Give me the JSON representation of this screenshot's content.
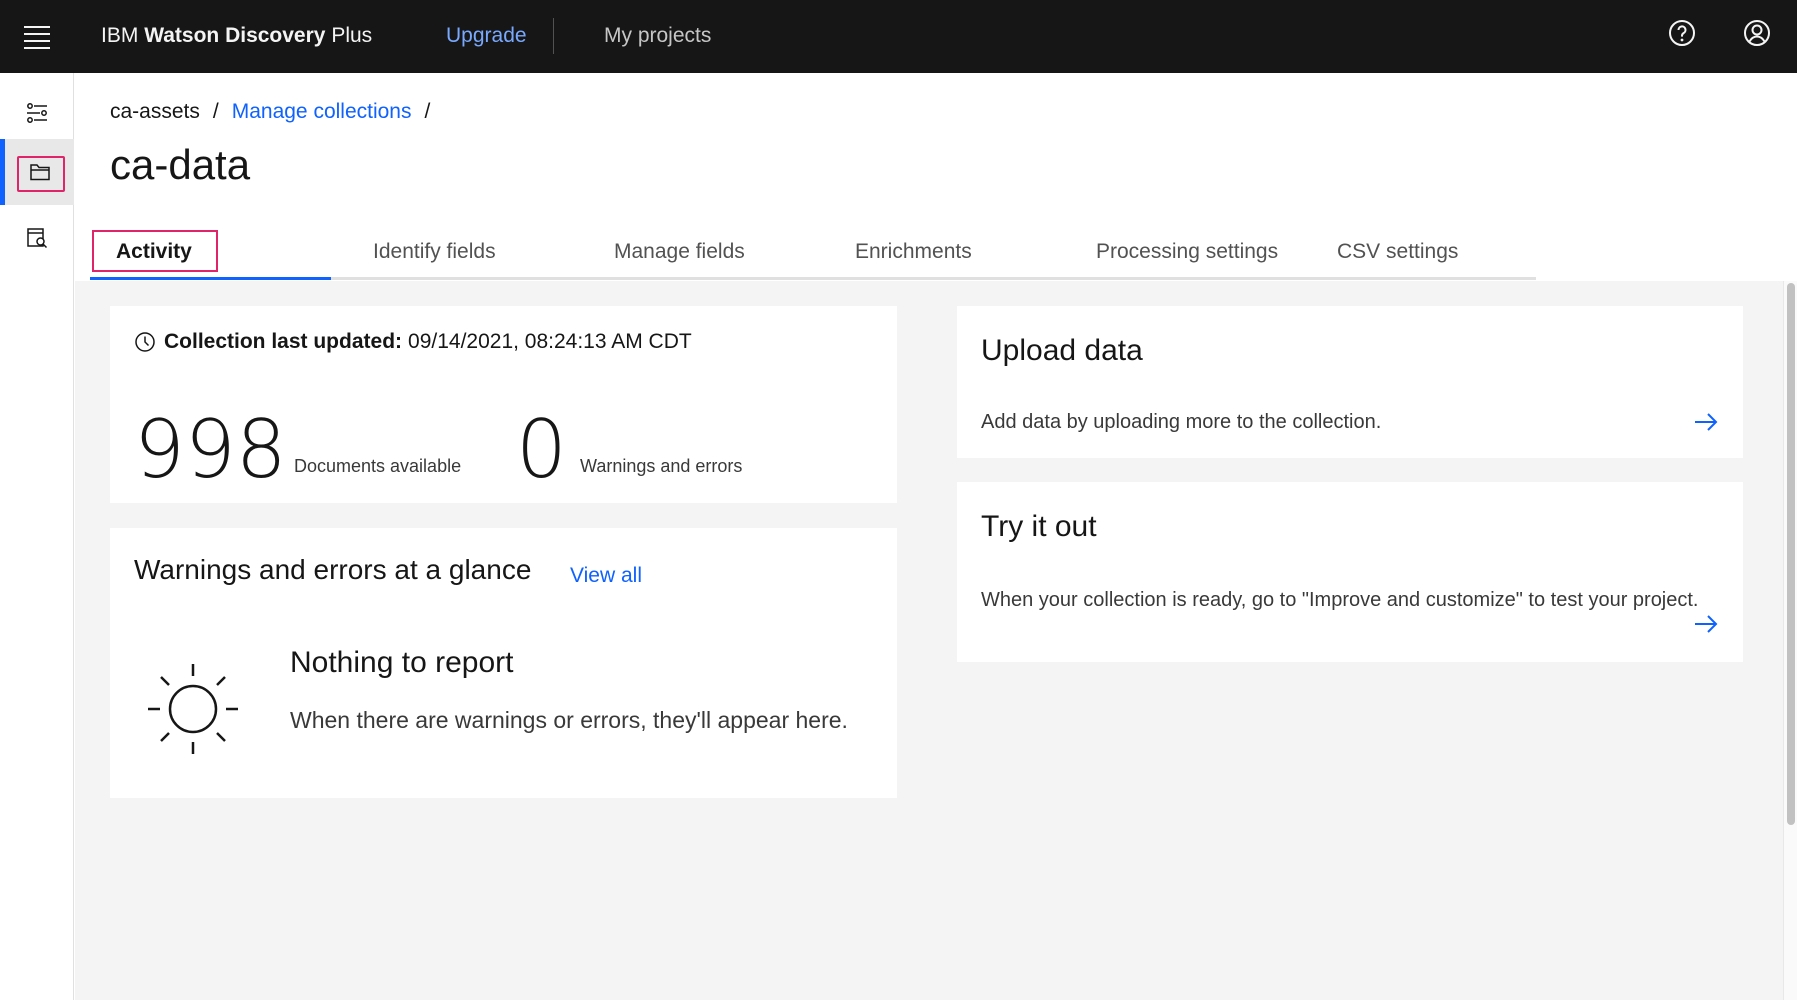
{
  "header": {
    "brand_prefix": "IBM",
    "brand_bold": "Watson Discovery",
    "brand_suffix": "Plus",
    "upgrade_label": "Upgrade",
    "my_projects_label": "My projects",
    "icons": [
      "menu-icon",
      "help-icon",
      "user-avatar-icon"
    ]
  },
  "rail": {
    "items": [
      {
        "icon": "settings-adjust-icon",
        "active": false
      },
      {
        "icon": "folder-icon",
        "active": true
      },
      {
        "icon": "data-search-icon",
        "active": false
      }
    ]
  },
  "breadcrumb": {
    "root": "ca-assets",
    "separator": "/",
    "link": "Manage collections"
  },
  "page": {
    "title": "ca-data"
  },
  "tabs": [
    {
      "label": "Activity",
      "active": true
    },
    {
      "label": "Identify fields",
      "active": false
    },
    {
      "label": "Manage fields",
      "active": false
    },
    {
      "label": "Enrichments",
      "active": false
    },
    {
      "label": "Processing settings",
      "active": false
    },
    {
      "label": "CSV settings",
      "active": false
    }
  ],
  "stats": {
    "updated_label": "Collection last updated:",
    "updated_value": "09/14/2021, 08:24:13 AM CDT",
    "documents_count": "998",
    "documents_label": "Documents available",
    "warnings_count": "0",
    "warnings_label": "Warnings and errors"
  },
  "warnings": {
    "title": "Warnings and errors at a glance",
    "view_all": "View all",
    "empty_title": "Nothing to report",
    "empty_body": "When there are warnings or errors, they'll appear here."
  },
  "upload": {
    "title": "Upload data",
    "body": "Add data by uploading more to the collection."
  },
  "try_it": {
    "title": "Try it out",
    "body": "When your collection is ready, go to \"Improve and customize\" to test your project."
  },
  "colors": {
    "header_bg": "#161616",
    "accent": "#0f62fe",
    "upgrade_link": "#78a9ff",
    "highlight": "#e0246a",
    "content_bg": "#f4f4f4"
  }
}
